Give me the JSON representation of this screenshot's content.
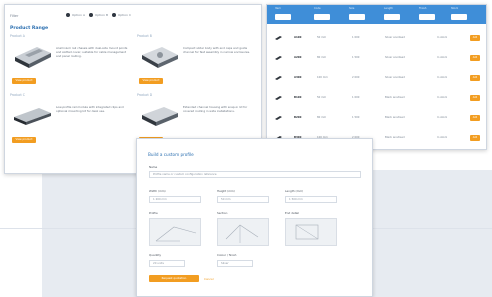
{
  "product_panel": {
    "filter_label": "Filter",
    "radios": [
      "Option A",
      "Option B",
      "Option C"
    ],
    "title": "Product Range",
    "cards": [
      {
        "title": "Product A",
        "desc": "Aluminium rail chassis with dual-side mount points and slotted cover; suitable for cable management and panel routing.",
        "button": "View product"
      },
      {
        "title": "Product B",
        "desc": "Compact slider body with end caps and guide channel for fast assembly in narrow enclosures.",
        "button": "View product"
      },
      {
        "title": "Product C",
        "desc": "Low-profile rail module with integrated clips and optional mounting kit for desk use.",
        "button": "View product"
      },
      {
        "title": "Product D",
        "desc": "Extended channel housing with snap-in lid for covered routing in wide installations.",
        "button": "View product"
      }
    ]
  },
  "table_panel": {
    "headers": [
      "Item",
      "Code",
      "Size",
      "Length",
      "Finish",
      "Stock"
    ],
    "rows": [
      {
        "code": "A100",
        "size": "50 mm",
        "length": "1 000",
        "finish": "Silver anodised",
        "stock": "In stock",
        "action": "Add"
      },
      {
        "code": "A200",
        "size": "80 mm",
        "length": "1 500",
        "finish": "Silver anodised",
        "stock": "In stock",
        "action": "Add"
      },
      {
        "code": "A300",
        "size": "100 mm",
        "length": "2 000",
        "finish": "Silver anodised",
        "stock": "In stock",
        "action": "Add"
      },
      {
        "code": "B100",
        "size": "50 mm",
        "length": "1 000",
        "finish": "Black anodised",
        "stock": "In stock",
        "action": "Add"
      },
      {
        "code": "B200",
        "size": "80 mm",
        "length": "1 500",
        "finish": "Black anodised",
        "stock": "In stock",
        "action": "Add"
      },
      {
        "code": "B300",
        "size": "100 mm",
        "length": "2 000",
        "finish": "Black anodised",
        "stock": "In stock",
        "action": "Add"
      }
    ]
  },
  "form_panel": {
    "title": "Build a custom profile",
    "name_label": "Name",
    "name_value": "Profile name or custom configuration reference",
    "fields": [
      {
        "label": "Width (mm)",
        "value": "1 200 mm"
      },
      {
        "label": "Height (mm)",
        "value": "50 mm"
      },
      {
        "label": "Length (mm)",
        "value": "1 500 mm"
      }
    ],
    "diagram_labels": [
      "Profile",
      "Section",
      "End detail"
    ],
    "extra_fields": [
      {
        "label": "Quantity",
        "value": "20 units"
      },
      {
        "label": "Colour / finish",
        "value": "Silver"
      }
    ],
    "submit": "Request quotation",
    "cancel": "Cancel"
  },
  "colors": {
    "accent": "#f29d21",
    "header_blue": "#3f8ed8",
    "title_blue": "#2b6fb0"
  }
}
